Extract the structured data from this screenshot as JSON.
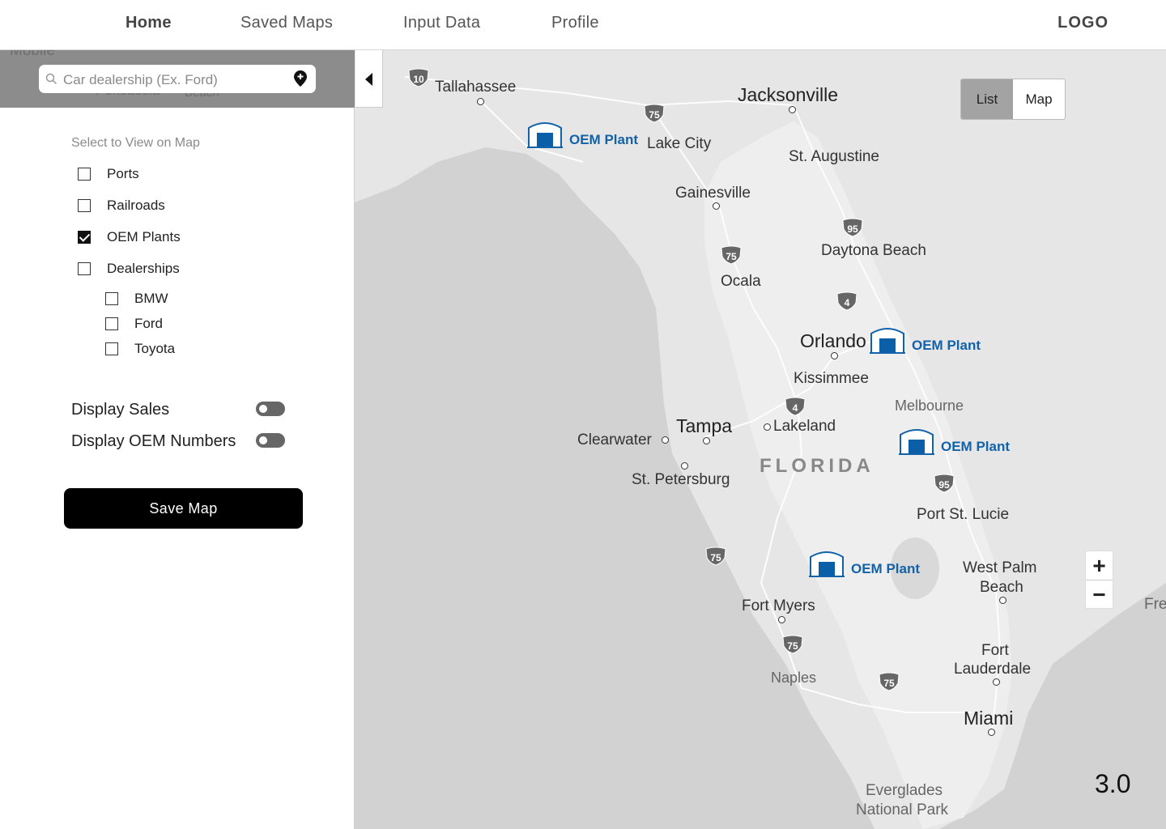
{
  "nav": {
    "items": [
      "Home",
      "Saved Maps",
      "Input Data",
      "Profile"
    ],
    "logo": "LOGO"
  },
  "search": {
    "placeholder": "Car dealership (Ex. Ford)",
    "background_labels": [
      "Mobile",
      "Pensacola",
      "Beach"
    ]
  },
  "filters": {
    "title": "Select to View on Map",
    "items": [
      {
        "label": "Ports",
        "checked": false
      },
      {
        "label": "Railroads",
        "checked": false
      },
      {
        "label": "OEM Plants",
        "checked": true
      },
      {
        "label": "Dealerships",
        "checked": false
      }
    ],
    "dealerships": [
      {
        "label": "BMW",
        "checked": false
      },
      {
        "label": "Ford",
        "checked": false
      },
      {
        "label": "Toyota",
        "checked": false
      }
    ]
  },
  "toggles": {
    "display_sales": {
      "label": "Display Sales",
      "on": false
    },
    "display_oem": {
      "label": "Display OEM Numbers",
      "on": false
    }
  },
  "save_button": "Save Map",
  "view_toggle": {
    "list": "List",
    "map": "Map",
    "selected": "List"
  },
  "zoom": {
    "in": "+",
    "out": "−"
  },
  "zoom_level": "3.0",
  "map": {
    "state": "FLORIDA",
    "oem_label": "OEM Plant",
    "cities": {
      "tallahassee": "Tallahassee",
      "jacksonville": "Jacksonville",
      "lake_city": "Lake City",
      "st_augustine": "St. Augustine",
      "gainesville": "Gainesville",
      "daytona": "Daytona Beach",
      "ocala": "Ocala",
      "orlando": "Orlando",
      "kissimmee": "Kissimmee",
      "melbourne": "Melbourne",
      "tampa": "Tampa",
      "lakeland": "Lakeland",
      "clearwater": "Clearwater",
      "st_petersburg": "St. Petersburg",
      "port_st_lucie": "Port St. Lucie",
      "west_palm_1": "West Palm",
      "west_palm_2": "Beach",
      "fort_myers": "Fort Myers",
      "naples": "Naples",
      "fort_laud_1": "Fort",
      "fort_laud_2": "Lauderdale",
      "miami": "Miami",
      "everglades_1": "Everglades",
      "everglades_2": "National Park",
      "freeport_partial": "Fre"
    },
    "highways": [
      "10",
      "75",
      "95",
      "75",
      "4",
      "4",
      "95",
      "75",
      "75",
      "75"
    ]
  }
}
